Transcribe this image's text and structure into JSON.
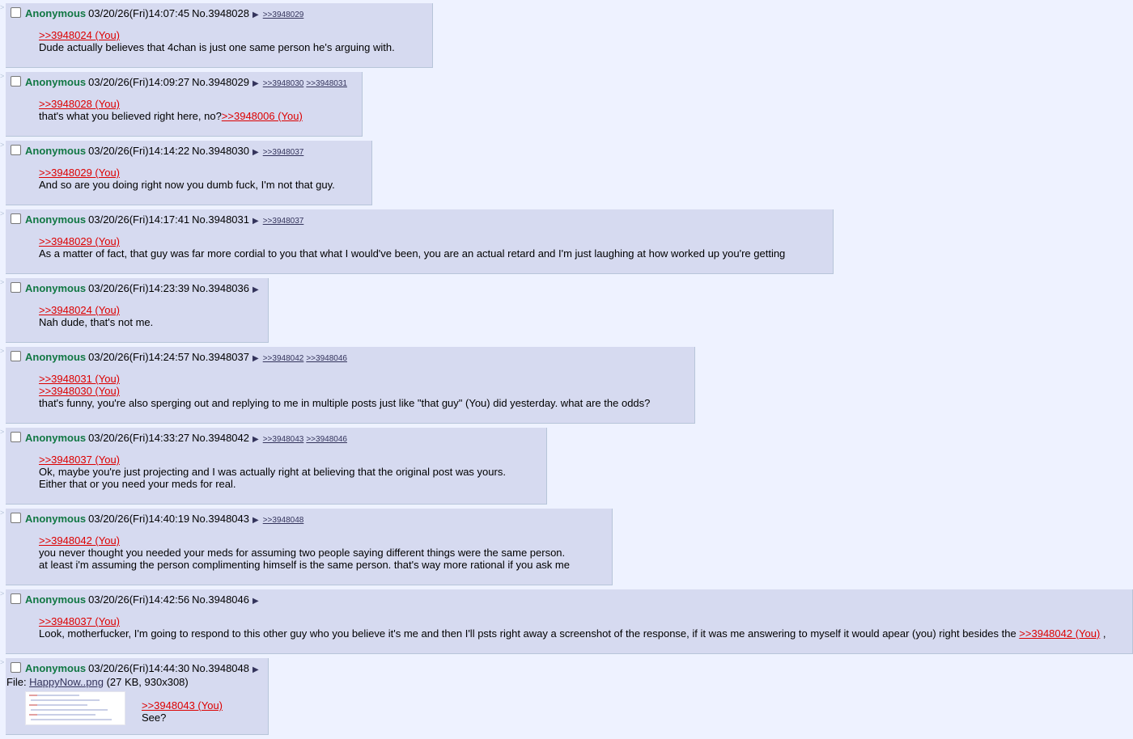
{
  "posts": [
    {
      "name": "Anonymous",
      "datetime": "03/20/26(Fri)14:07:45",
      "num": "No.3948028",
      "backlinks": [
        ">>3948029"
      ],
      "lines": [
        [
          {
            "t": "q",
            "s": ">>3948024 (You)"
          }
        ],
        [
          {
            "t": "x",
            "s": "Dude actually believes that 4chan is just one same person he's arguing with."
          }
        ]
      ]
    },
    {
      "name": "Anonymous",
      "datetime": "03/20/26(Fri)14:09:27",
      "num": "No.3948029",
      "backlinks": [
        ">>3948030",
        ">>3948031"
      ],
      "lines": [
        [
          {
            "t": "q",
            "s": ">>3948028 (You)"
          }
        ],
        [
          {
            "t": "x",
            "s": "that's what you believed right here, no?"
          },
          {
            "t": "q",
            "s": ">>3948006 (You)"
          }
        ]
      ]
    },
    {
      "name": "Anonymous",
      "datetime": "03/20/26(Fri)14:14:22",
      "num": "No.3948030",
      "backlinks": [
        ">>3948037"
      ],
      "lines": [
        [
          {
            "t": "q",
            "s": ">>3948029 (You)"
          }
        ],
        [
          {
            "t": "x",
            "s": "And so are you doing right now you dumb fuck, I'm not that guy."
          }
        ]
      ]
    },
    {
      "name": "Anonymous",
      "datetime": "03/20/26(Fri)14:17:41",
      "num": "No.3948031",
      "backlinks": [
        ">>3948037"
      ],
      "lines": [
        [
          {
            "t": "q",
            "s": ">>3948029 (You)"
          }
        ],
        [
          {
            "t": "x",
            "s": "As a matter of fact, that guy was far more cordial to you that what I would've been, you are an actual retard and I'm just laughing at how worked up you're getting"
          }
        ]
      ]
    },
    {
      "name": "Anonymous",
      "datetime": "03/20/26(Fri)14:23:39",
      "num": "No.3948036",
      "backlinks": [],
      "lines": [
        [
          {
            "t": "q",
            "s": ">>3948024 (You)"
          }
        ],
        [
          {
            "t": "x",
            "s": "Nah dude, that's not me."
          }
        ]
      ]
    },
    {
      "name": "Anonymous",
      "datetime": "03/20/26(Fri)14:24:57",
      "num": "No.3948037",
      "backlinks": [
        ">>3948042",
        ">>3948046"
      ],
      "lines": [
        [
          {
            "t": "q",
            "s": ">>3948031 (You)"
          }
        ],
        [
          {
            "t": "q",
            "s": ">>3948030 (You)"
          }
        ],
        [
          {
            "t": "x",
            "s": "that's funny, you're also sperging out and replying to me in multiple posts just like \"that guy\" (You) did yesterday. what are the odds?"
          }
        ]
      ]
    },
    {
      "name": "Anonymous",
      "datetime": "03/20/26(Fri)14:33:27",
      "num": "No.3948042",
      "backlinks": [
        ">>3948043",
        ">>3948046"
      ],
      "lines": [
        [
          {
            "t": "q",
            "s": ">>3948037 (You)"
          }
        ],
        [
          {
            "t": "x",
            "s": "Ok, maybe you're just projecting and I was actually right at believing that the original post was yours."
          }
        ],
        [
          {
            "t": "x",
            "s": "Either that or you need your meds for real."
          }
        ]
      ]
    },
    {
      "name": "Anonymous",
      "datetime": "03/20/26(Fri)14:40:19",
      "num": "No.3948043",
      "backlinks": [
        ">>3948048"
      ],
      "lines": [
        [
          {
            "t": "q",
            "s": ">>3948042 (You)"
          }
        ],
        [
          {
            "t": "x",
            "s": "you never thought you needed your meds for assuming two people saying different things were the same person."
          }
        ],
        [
          {
            "t": "x",
            "s": "at least i'm assuming the person complimenting himself is the same person. that's way more rational if you ask me"
          }
        ]
      ]
    },
    {
      "name": "Anonymous",
      "datetime": "03/20/26(Fri)14:42:56",
      "num": "No.3948046",
      "backlinks": [],
      "lines": [
        [
          {
            "t": "q",
            "s": ">>3948037 (You)"
          }
        ],
        [
          {
            "t": "x",
            "s": "Look, motherfucker, I'm going to respond to this other guy who you believe it's me and then I'll psts right away a screenshot of the response, if it was me answering to myself it would apear (you) right besides the "
          },
          {
            "t": "q",
            "s": ">>3948042 (You)"
          },
          {
            "t": "x",
            "s": " ,"
          }
        ]
      ]
    },
    {
      "name": "Anonymous",
      "datetime": "03/20/26(Fri)14:44:30",
      "num": "No.3948048",
      "backlinks": [],
      "file": {
        "label": "File: ",
        "filename": "HappyNow..png",
        "meta": " (27 KB, 930x308)"
      },
      "lines": [
        [
          {
            "t": "q",
            "s": ">>3948043 (You)"
          }
        ],
        [
          {
            "t": "x",
            "s": "See?"
          }
        ]
      ]
    }
  ],
  "icons": {
    "menu": "triangle-right-icon",
    "side": "reply-arrow-icon",
    "checkbox": "checkbox-icon"
  }
}
